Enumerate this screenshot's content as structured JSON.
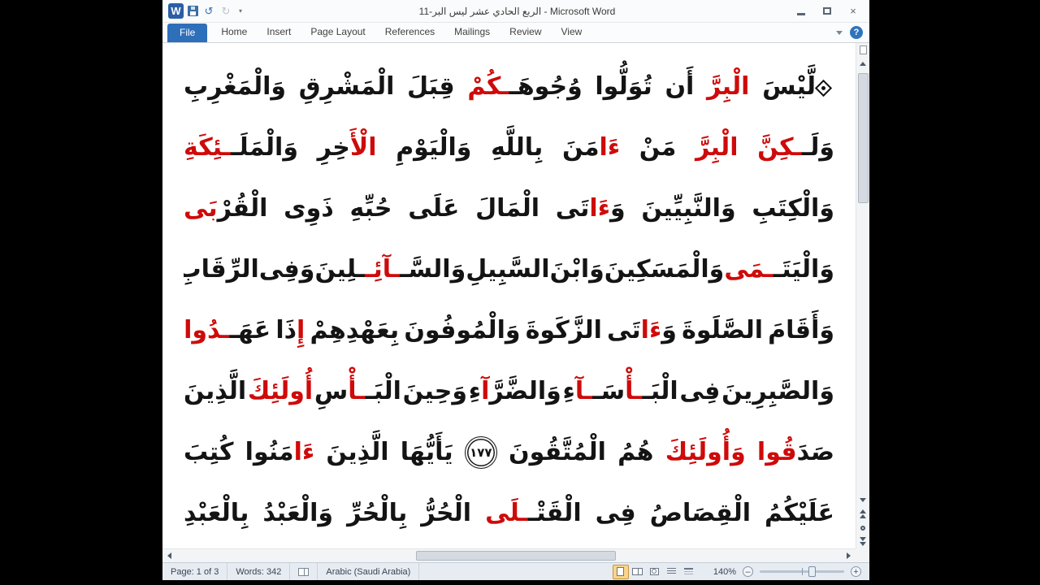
{
  "window": {
    "title": "الربع الحادي عشر ليس البر-11  -  Microsoft Word",
    "app_icon_letter": "W",
    "close_glyph": "×"
  },
  "qat": {
    "undo_glyph": "↺",
    "redo_glyph": "↻",
    "dropdown_glyph": "▾"
  },
  "ribbon": {
    "file_tab": "File",
    "tabs": [
      "Home",
      "Insert",
      "Page Layout",
      "References",
      "Mailings",
      "Review",
      "View"
    ],
    "help_glyph": "?"
  },
  "colors": {
    "tajweed_red": "#cf0a0a",
    "file_tab_blue": "#2e6fba",
    "active_view_highlight": "#f7d58c"
  },
  "document": {
    "ayah_number": "١٧٧",
    "lines": [
      [
        {
          "type": "hizb"
        },
        {
          "t": "لَّيْسَ",
          "c": "k",
          "j": true
        },
        {
          "t": "الْبِرَّ",
          "c": "r"
        },
        {
          "t": "أَن",
          "c": "k"
        },
        {
          "t": "تُوَلُّوا",
          "c": "k"
        },
        {
          "t": "وُجُوهَـ",
          "c": "k"
        },
        {
          "t": "ـكُمْ",
          "c": "r",
          "j": true
        },
        {
          "t": "قِبَلَ",
          "c": "k"
        },
        {
          "t": "الْمَشْرِقِ",
          "c": "k"
        },
        {
          "t": "وَالْمَغْرِبِ",
          "c": "k"
        }
      ],
      [
        {
          "t": "وَلَـ",
          "c": "k"
        },
        {
          "t": "ـكِنَّ",
          "c": "r",
          "j": true
        },
        {
          "t": "الْبِرَّ",
          "c": "r"
        },
        {
          "t": "مَنْ",
          "c": "k"
        },
        {
          "t": "ءَا",
          "c": "r"
        },
        {
          "t": "مَنَ",
          "c": "k",
          "j": true
        },
        {
          "t": "بِاللَّهِ",
          "c": "k"
        },
        {
          "t": "وَالْيَوْمِ",
          "c": "k"
        },
        {
          "t": "الْأَ",
          "c": "r"
        },
        {
          "t": "خِرِ",
          "c": "k",
          "j": true
        },
        {
          "t": "وَالْمَلَـ",
          "c": "k"
        },
        {
          "t": "ـئِكَةِ",
          "c": "r",
          "j": true
        }
      ],
      [
        {
          "t": "وَالْكِتَبِ",
          "c": "k"
        },
        {
          "t": "وَالنَّبِيِّينَ",
          "c": "k"
        },
        {
          "t": "وَ",
          "c": "k"
        },
        {
          "t": "ءَا",
          "c": "r",
          "j": true
        },
        {
          "t": "تَى",
          "c": "k",
          "j": true
        },
        {
          "t": "الْمَالَ",
          "c": "k"
        },
        {
          "t": "عَلَى",
          "c": "k"
        },
        {
          "t": "حُبِّهِ",
          "c": "k"
        },
        {
          "t": "ذَوِى",
          "c": "k"
        },
        {
          "t": "الْقُرْ",
          "c": "k"
        },
        {
          "t": "بَى",
          "c": "r",
          "j": true
        }
      ],
      [
        {
          "t": "وَالْيَتَـ",
          "c": "k"
        },
        {
          "t": "ـمَى",
          "c": "r",
          "j": true
        },
        {
          "t": "وَالْمَسَكِينَ",
          "c": "k"
        },
        {
          "t": "وَابْنَ",
          "c": "k"
        },
        {
          "t": "السَّبِيلِ",
          "c": "k"
        },
        {
          "t": "وَالسَّـ",
          "c": "k"
        },
        {
          "t": "ـآئِـ",
          "c": "r",
          "j": true
        },
        {
          "t": "ـلِينَ",
          "c": "k",
          "j": true
        },
        {
          "t": "وَفِى",
          "c": "k"
        },
        {
          "t": "الرِّقَابِ",
          "c": "k"
        }
      ],
      [
        {
          "t": "وَأَقَامَ",
          "c": "k"
        },
        {
          "t": "الصَّلَوةَ",
          "c": "k"
        },
        {
          "t": "وَ",
          "c": "k"
        },
        {
          "t": "ءَا",
          "c": "r",
          "j": true
        },
        {
          "t": "تَى",
          "c": "k",
          "j": true
        },
        {
          "t": "الزَّكَوةَ",
          "c": "k"
        },
        {
          "t": "وَالْمُوفُونَ",
          "c": "k"
        },
        {
          "t": "بِعَهْدِهِمْ",
          "c": "k"
        },
        {
          "t": "إِ",
          "c": "r"
        },
        {
          "t": "ذَا",
          "c": "k",
          "j": true
        },
        {
          "t": "عَهَـ",
          "c": "k"
        },
        {
          "t": "ـدُوا",
          "c": "r",
          "j": true
        }
      ],
      [
        {
          "t": "وَالصَّبِرِينَ",
          "c": "k"
        },
        {
          "t": "فِى",
          "c": "k"
        },
        {
          "t": "الْبَـ",
          "c": "k"
        },
        {
          "t": "ـأْ",
          "c": "r",
          "j": true
        },
        {
          "t": "سَـ",
          "c": "k",
          "j": true
        },
        {
          "t": "ـآ",
          "c": "r",
          "j": true
        },
        {
          "t": "ءِ",
          "c": "k",
          "j": true
        },
        {
          "t": "وَالضَّرَّ",
          "c": "k"
        },
        {
          "t": "آ",
          "c": "r",
          "j": true
        },
        {
          "t": "ءِ",
          "c": "k",
          "j": true
        },
        {
          "t": "وَحِينَ",
          "c": "k"
        },
        {
          "t": "الْبَـ",
          "c": "k"
        },
        {
          "t": "ـأْ",
          "c": "r",
          "j": true
        },
        {
          "t": "سِ",
          "c": "k",
          "j": true
        },
        {
          "t": "أُولَئِكَ",
          "c": "r"
        },
        {
          "t": "الَّذِينَ",
          "c": "k"
        }
      ],
      [
        {
          "t": "صَدَ",
          "c": "k"
        },
        {
          "t": "قُوا",
          "c": "r",
          "j": true
        },
        {
          "t": "وَأُولَئِكَ",
          "c": "r"
        },
        {
          "t": "هُمُ",
          "c": "k"
        },
        {
          "t": "الْمُتَّقُونَ",
          "c": "k"
        },
        {
          "type": "ayah",
          "t": "١٧٧"
        },
        {
          "t": "يَأَيُّهَا",
          "c": "k"
        },
        {
          "t": "الَّذِينَ",
          "c": "k"
        },
        {
          "t": "ءَا",
          "c": "r"
        },
        {
          "t": "مَنُوا",
          "c": "k",
          "j": true
        },
        {
          "t": "كُتِبَ",
          "c": "k"
        }
      ],
      [
        {
          "t": "عَلَيْكُمُ",
          "c": "k"
        },
        {
          "t": "الْقِصَاصُ",
          "c": "k"
        },
        {
          "t": "فِى",
          "c": "k"
        },
        {
          "t": "الْقَتْـ",
          "c": "k"
        },
        {
          "t": "ـلَى",
          "c": "r",
          "j": true
        },
        {
          "t": "الْحُرُّ",
          "c": "k"
        },
        {
          "t": "بِالْحُرِّ",
          "c": "k"
        },
        {
          "t": "وَالْعَبْدُ",
          "c": "k"
        },
        {
          "t": "بِالْعَبْدِ",
          "c": "k"
        }
      ]
    ]
  },
  "statusbar": {
    "page": "Page: 1 of 3",
    "words": "Words: 342",
    "language": "Arabic (Saudi Arabia)",
    "zoom": "140%",
    "zoom_minus": "–",
    "zoom_plus": "+"
  }
}
